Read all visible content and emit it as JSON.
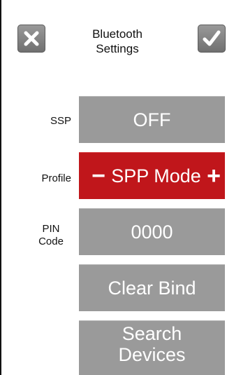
{
  "header": {
    "title_line1": "Bluetooth",
    "title_line2": "Settings",
    "cancel_icon": "close-icon",
    "confirm_icon": "checkmark-icon"
  },
  "rows": {
    "ssp": {
      "label": "SSP",
      "value": "OFF"
    },
    "profile": {
      "label": "Profile",
      "value": "SPP  Mode",
      "decrement": "−",
      "increment": "+"
    },
    "pin": {
      "label_line1": "PIN",
      "label_line2": "Code",
      "value": "0000"
    }
  },
  "actions": {
    "clear_bind": "Clear Bind",
    "search_line1": "Search",
    "search_line2": "Devices"
  },
  "colors": {
    "button_gray": "#9a9a9a",
    "accent_red": "#c0161b",
    "icon_gray": "#7d7d7d"
  }
}
